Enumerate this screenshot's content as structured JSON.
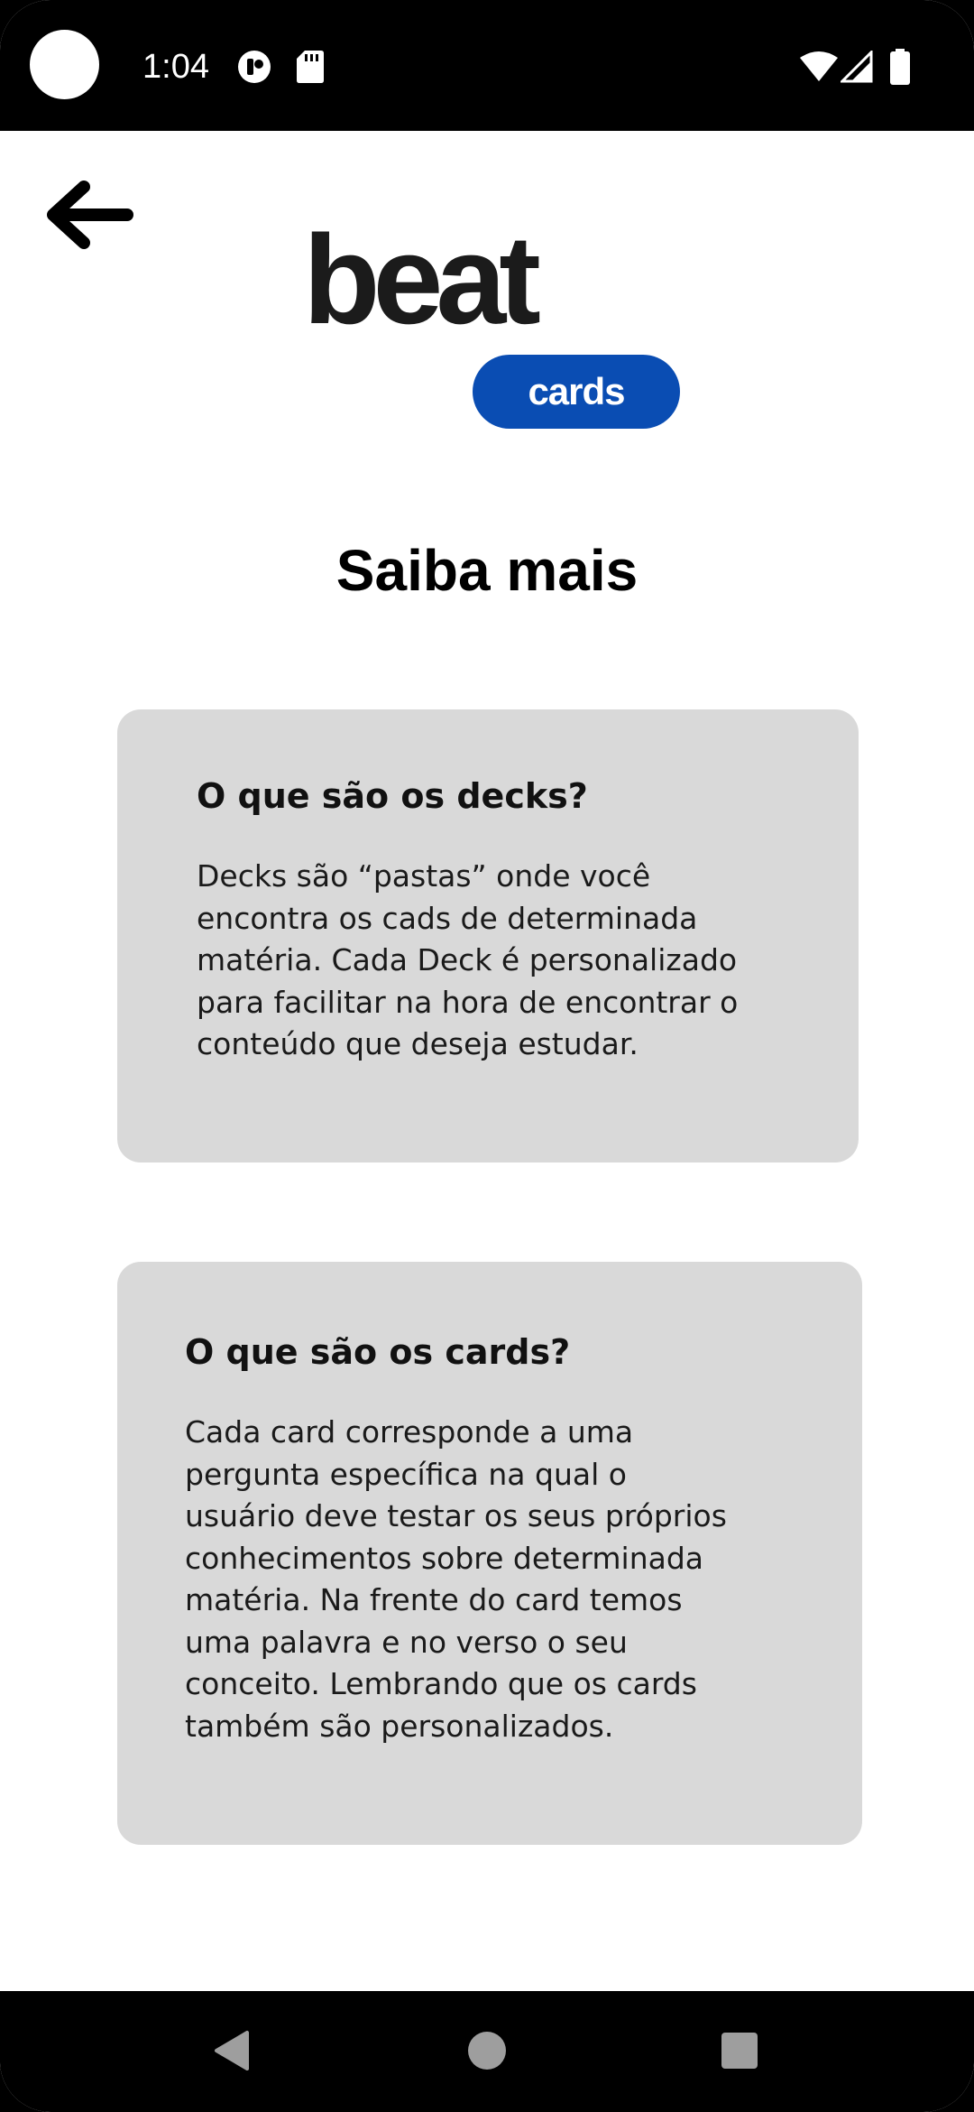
{
  "status_bar": {
    "time": "1:04",
    "icons": [
      "camera-cutout",
      "notification-icon",
      "sd-card-icon",
      "wifi-icon",
      "signal-icon",
      "battery-icon"
    ]
  },
  "header": {
    "back_icon": "arrow-left-icon",
    "logo": {
      "word": "beat",
      "pill": "cards",
      "pill_color": "#0a4db3"
    }
  },
  "page": {
    "title": "Saiba mais"
  },
  "cards": [
    {
      "title": "O que são os decks?",
      "lines": [
        "Decks são “pastas” onde você",
        "encontra os cads de determinada",
        "matéria. Cada Deck é personalizado",
        "para facilitar na hora de encontrar o",
        "conteúdo que deseja estudar."
      ]
    },
    {
      "title": "O que são os cards?",
      "lines": [
        "Cada card corresponde a uma",
        "pergunta específica na qual o",
        "usuário deve testar os seus próprios",
        "conhecimentos sobre determinada",
        "matéria. Na frente do card temos",
        "uma palavra e no verso o seu",
        "conceito. Lembrando que os cards",
        "também são personalizados."
      ]
    }
  ],
  "colors": {
    "card_background": "#d9d9d9",
    "bars": "#000000"
  },
  "nav_bar": {
    "buttons": [
      "back-triangle-icon",
      "home-circle-icon",
      "recents-square-icon"
    ]
  }
}
